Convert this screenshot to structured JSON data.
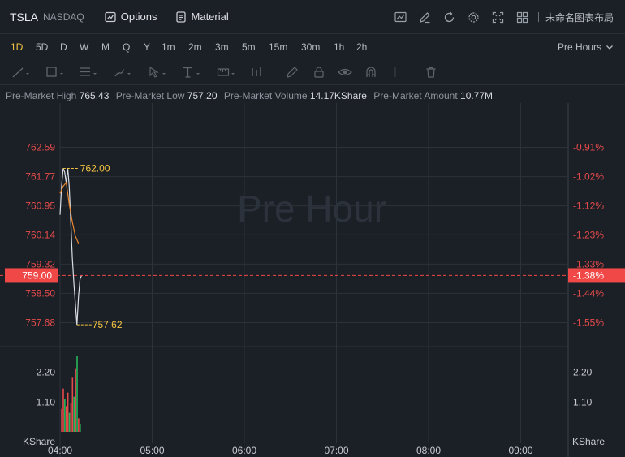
{
  "header": {
    "symbol": "TSLA",
    "exchange": "NASDAQ",
    "options_label": "Options",
    "material_label": "Material",
    "layout_name": "未命名图表布局"
  },
  "intervals": {
    "items": [
      "1D",
      "5D",
      "D",
      "W",
      "M",
      "Q",
      "Y",
      "1m",
      "2m",
      "3m",
      "5m",
      "15m",
      "30m",
      "1h",
      "2h"
    ],
    "active": "1D",
    "session_label": "Pre Hours"
  },
  "info": {
    "high_label": "Pre-Market High",
    "high_value": "765.43",
    "low_label": "Pre-Market Low",
    "low_value": "757.20",
    "volume_label": "Pre-Market Volume",
    "volume_value": "14.17KShare",
    "amount_label": "Pre-Market Amount",
    "amount_value": "10.77M"
  },
  "colors": {
    "up": "#e54b4b",
    "down": "#26b85a",
    "accent": "#f5c542",
    "current": "#f04747"
  },
  "chart_data": {
    "type": "line",
    "watermark": "Pre Hour",
    "price_ticks": [
      "762.59",
      "761.77",
      "760.95",
      "760.14",
      "759.32",
      "758.50",
      "757.68"
    ],
    "percent_ticks": [
      "-0.91%",
      "-1.02%",
      "-1.12%",
      "-1.23%",
      "-1.33%",
      "-1.44%",
      "-1.55%"
    ],
    "current_price": "759.00",
    "current_percent": "-1.38%",
    "high_marker": "762.00",
    "low_marker": "757.62",
    "volume_ticks": [
      "2.20",
      "1.10"
    ],
    "volume_unit": "KShare",
    "time_ticks": [
      "04:00",
      "05:00",
      "06:00",
      "07:00",
      "08:00",
      "09:00"
    ],
    "ylim": [
      757.2,
      763.2
    ],
    "price_series": {
      "x": [
        "04:00",
        "04:01",
        "04:02",
        "04:03",
        "04:04",
        "04:05",
        "04:06",
        "04:07",
        "04:08",
        "04:09",
        "04:10",
        "04:11",
        "04:12",
        "04:13",
        "04:14"
      ],
      "y": [
        760.7,
        761.5,
        762.0,
        761.9,
        761.6,
        762.0,
        761.5,
        760.5,
        759.5,
        758.8,
        758.2,
        757.62,
        758.4,
        758.9,
        759.0
      ]
    },
    "avg_series": {
      "x": [
        "04:00",
        "04:02",
        "04:04",
        "04:06",
        "04:08",
        "04:10",
        "04:12"
      ],
      "y": [
        761.3,
        761.5,
        761.6,
        761.0,
        760.5,
        760.1,
        759.9
      ]
    },
    "volume_bars": [
      {
        "t": "04:01",
        "v": 0.85,
        "dir": "up"
      },
      {
        "t": "04:02",
        "v": 1.6,
        "dir": "up"
      },
      {
        "t": "04:03",
        "v": 1.2,
        "dir": "down"
      },
      {
        "t": "04:04",
        "v": 0.95,
        "dir": "up"
      },
      {
        "t": "04:05",
        "v": 1.45,
        "dir": "up"
      },
      {
        "t": "04:06",
        "v": 0.7,
        "dir": "down"
      },
      {
        "t": "04:07",
        "v": 1.05,
        "dir": "up"
      },
      {
        "t": "04:08",
        "v": 2.0,
        "dir": "up"
      },
      {
        "t": "04:09",
        "v": 1.3,
        "dir": "down"
      },
      {
        "t": "04:10",
        "v": 2.35,
        "dir": "up"
      },
      {
        "t": "04:11",
        "v": 2.8,
        "dir": "down"
      },
      {
        "t": "04:12",
        "v": 0.5,
        "dir": "up"
      },
      {
        "t": "04:13",
        "v": 0.3,
        "dir": "down"
      }
    ]
  }
}
